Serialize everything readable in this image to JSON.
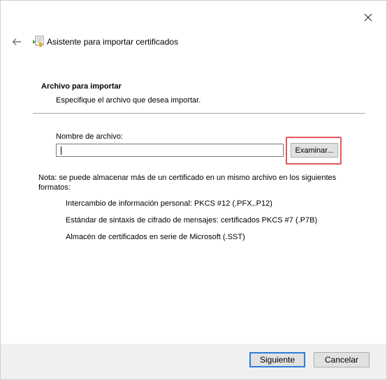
{
  "wizard": {
    "title": "Asistente para importar certificados"
  },
  "section": {
    "title": "Archivo para importar",
    "description": "Especifique el archivo que desea importar."
  },
  "file_field": {
    "label": "Nombre de archivo:",
    "value": "",
    "browse_label": "Examinar..."
  },
  "note": {
    "text": "Nota: se puede almacenar más de un certificado en un mismo archivo en los siguientes formatos:",
    "formats": [
      "Intercambio de información personal: PKCS #12 (.PFX,.P12)",
      "Estándar de sintaxis de cifrado de mensajes: certificados PKCS #7 (.P7B)",
      "Almacén de certificados en serie de Microsoft (.SST)"
    ]
  },
  "footer": {
    "next_label": "Siguiente",
    "cancel_label": "Cancelar"
  },
  "colors": {
    "highlight": "#e0585a",
    "default_button_border": "#2f7bd6"
  },
  "icons": {
    "close": "close-icon",
    "back": "back-arrow-icon",
    "wizard": "certificate-wizard-icon"
  }
}
